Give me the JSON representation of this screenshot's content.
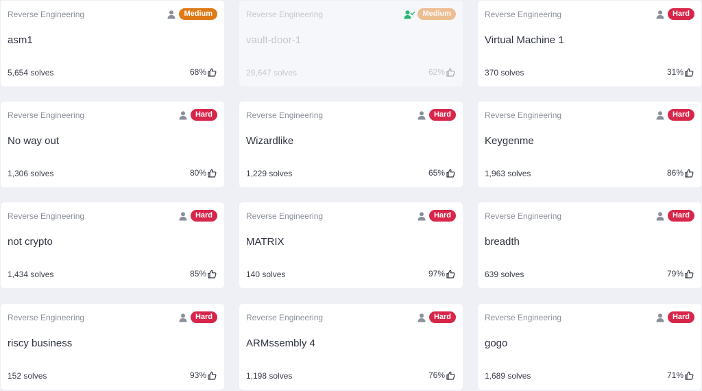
{
  "colors": {
    "medium_badge": "#e07a16",
    "hard_badge": "#d7264a",
    "solved_check": "#2bb673",
    "card_bg": "#ffffff",
    "page_bg": "#eef0f5"
  },
  "cards": [
    {
      "category": "Reverse Engineering",
      "title": "asm1",
      "difficulty": "Medium",
      "solves": "5,654 solves",
      "rating": "68%",
      "solved": false,
      "user_icon": "user-icon"
    },
    {
      "category": "Reverse Engineering",
      "title": "vault-door-1",
      "difficulty": "Medium",
      "solves": "29,647 solves",
      "rating": "62%",
      "solved": true,
      "user_icon": "user-check-icon"
    },
    {
      "category": "Reverse Engineering",
      "title": "Virtual Machine 1",
      "difficulty": "Hard",
      "solves": "370 solves",
      "rating": "31%",
      "solved": false,
      "user_icon": "user-icon"
    },
    {
      "category": "Reverse Engineering",
      "title": "No way out",
      "difficulty": "Hard",
      "solves": "1,306 solves",
      "rating": "80%",
      "solved": false,
      "user_icon": "user-icon"
    },
    {
      "category": "Reverse Engineering",
      "title": "Wizardlike",
      "difficulty": "Hard",
      "solves": "1,229 solves",
      "rating": "65%",
      "solved": false,
      "user_icon": "user-icon"
    },
    {
      "category": "Reverse Engineering",
      "title": "Keygenme",
      "difficulty": "Hard",
      "solves": "1,963 solves",
      "rating": "86%",
      "solved": false,
      "user_icon": "user-icon"
    },
    {
      "category": "Reverse Engineering",
      "title": "not crypto",
      "difficulty": "Hard",
      "solves": "1,434 solves",
      "rating": "85%",
      "solved": false,
      "user_icon": "user-icon"
    },
    {
      "category": "Reverse Engineering",
      "title": "MATRIX",
      "difficulty": "Hard",
      "solves": "140 solves",
      "rating": "97%",
      "solved": false,
      "user_icon": "user-icon"
    },
    {
      "category": "Reverse Engineering",
      "title": "breadth",
      "difficulty": "Hard",
      "solves": "639 solves",
      "rating": "79%",
      "solved": false,
      "user_icon": "user-icon"
    },
    {
      "category": "Reverse Engineering",
      "title": "riscy business",
      "difficulty": "Hard",
      "solves": "152 solves",
      "rating": "93%",
      "solved": false,
      "user_icon": "user-icon"
    },
    {
      "category": "Reverse Engineering",
      "title": "ARMssembly 4",
      "difficulty": "Hard",
      "solves": "1,198 solves",
      "rating": "76%",
      "solved": false,
      "user_icon": "user-icon"
    },
    {
      "category": "Reverse Engineering",
      "title": "gogo",
      "difficulty": "Hard",
      "solves": "1,689 solves",
      "rating": "71%",
      "solved": false,
      "user_icon": "user-icon"
    }
  ]
}
